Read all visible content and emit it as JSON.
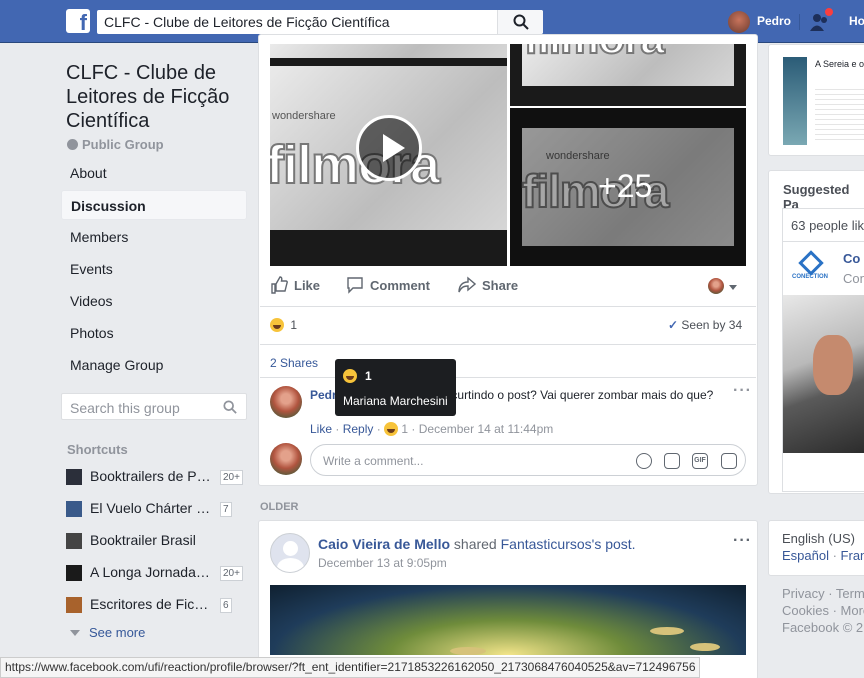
{
  "topbar": {
    "logo": "f",
    "search_value": "CLFC - Clube de Leitores de Ficção Científica",
    "user_name": "Pedro",
    "home_label": "Ho"
  },
  "group": {
    "title": "CLFC - Clube de Leitores de Ficção Científica",
    "privacy": "Public Group"
  },
  "nav": [
    {
      "label": "About"
    },
    {
      "label": "Discussion",
      "active": true
    },
    {
      "label": "Members"
    },
    {
      "label": "Events"
    },
    {
      "label": "Videos"
    },
    {
      "label": "Photos"
    },
    {
      "label": "Manage Group"
    }
  ],
  "group_search": {
    "placeholder": "Search this group"
  },
  "shortcuts": {
    "heading": "Shortcuts",
    "items": [
      {
        "label": "Booktrailers de Pe...",
        "count": "20+"
      },
      {
        "label": "El Vuelo Chárter par...",
        "count": "7"
      },
      {
        "label": "Booktrailer Brasil",
        "count": ""
      },
      {
        "label": "A Longa Jornada d...",
        "count": "20+"
      },
      {
        "label": "Escritores de Ficção ...",
        "count": "6"
      }
    ],
    "see_more": "See more"
  },
  "post1": {
    "media": {
      "brand": "wondershare",
      "word": "filmora",
      "more_count": "+25"
    },
    "actions": {
      "like": "Like",
      "comment": "Comment",
      "share": "Share"
    },
    "reactions_count": "1",
    "seen": "Seen by 34",
    "shares": "2 Shares",
    "tooltip": {
      "count": "1",
      "name": "Mariana Marchesini"
    },
    "comment": {
      "author": "Pedr",
      "text_start": "o",
      "text_end": "esini curtindo o post? Vai querer zombar mais do que",
      "text_line2": "?",
      "like": "Like",
      "reply": "Reply",
      "reaction_count": "1",
      "time": "December 14 at 11:44pm"
    },
    "write_placeholder": "Write a comment..."
  },
  "older_label": "OLDER",
  "post2": {
    "author": "Caio Vieira de Mello",
    "action": "shared",
    "page": "Fantasticursos",
    "suffix": "'s post.",
    "time": "December 13 at 9:05pm"
  },
  "right": {
    "ad_title": "A Sereia e o p... desencontros",
    "suggested_heading": "Suggested Pa",
    "people_like": "63 people lik",
    "page_name": "Co",
    "page_sub": "Con",
    "page_logo_text": "CONECTION",
    "lang_current": "English (US)",
    "lang_other1": "Español",
    "lang_other2": "Fran",
    "footer1": "Privacy · Term",
    "footer2": "Cookies · More",
    "footer3": "Facebook © 2"
  },
  "status_bar": "https://www.facebook.com/ufi/reaction/profile/browser/?ft_ent_identifier=2171853226162050_2173068476040525&av=712496756",
  "colors": {
    "brand": "#4267b2",
    "link": "#385898",
    "bg": "#e9ebee"
  }
}
